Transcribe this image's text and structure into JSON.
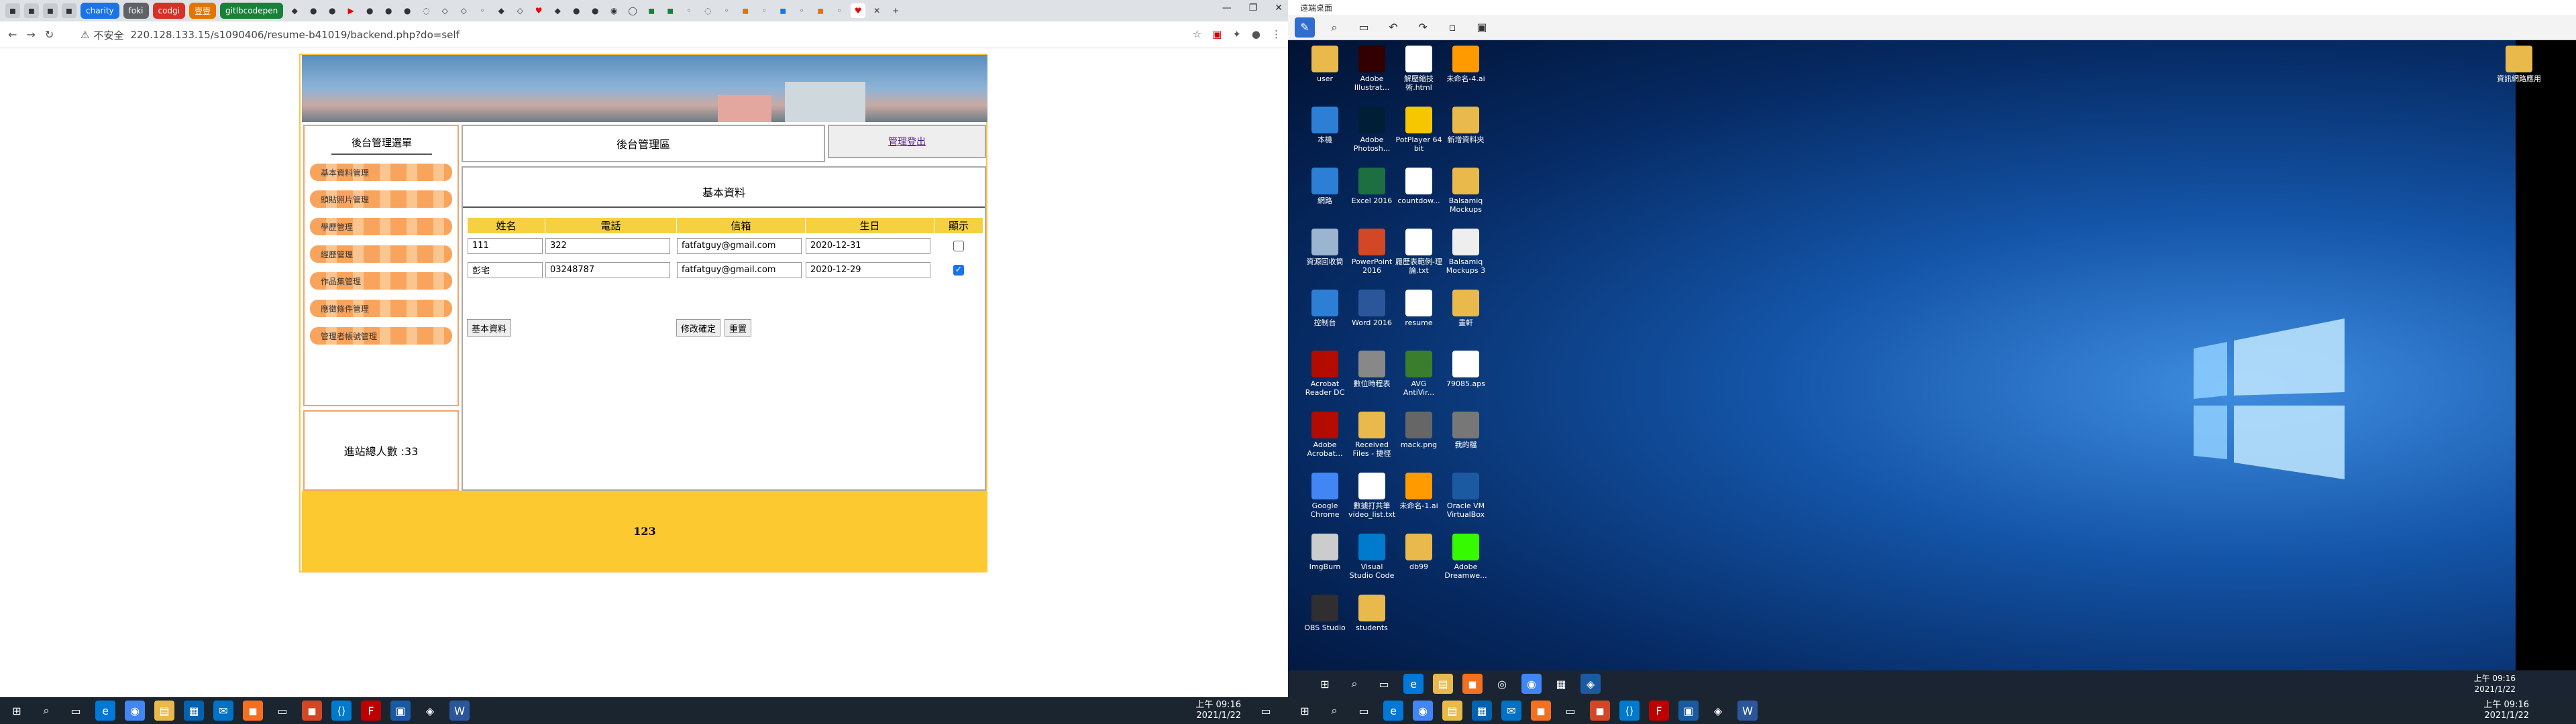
{
  "browser": {
    "tabs": [
      "charity",
      "foki",
      "codgi",
      "壹壹",
      "gitlbcodepen"
    ],
    "tab_colors": [
      "#1a73e8",
      "#5f6368",
      "#d93025",
      "#e37400",
      "#188038"
    ],
    "security_label": "不安全",
    "url": "220.128.133.15/s1090406/resume-b41019/backend.php?do=self"
  },
  "site": {
    "menu_title": "後台管理選單",
    "menu_items": [
      "基本資料管理",
      "頭貼照片管理",
      "學歷管理",
      "經歷管理",
      "作品集管理",
      "應徵條件管理",
      "管理者帳號管理"
    ],
    "visit_label": "進站總人數 :33",
    "header_title": "後台管理區",
    "logout_label": "管理登出",
    "content_title": "基本資料",
    "table": {
      "headers": [
        "姓名",
        "電話",
        "信箱",
        "生日",
        "顯示"
      ],
      "rows": [
        {
          "name": "111",
          "phone": "322",
          "email": "fatfatguy@gmail.com",
          "birthday": "2020-12-31",
          "show": false
        },
        {
          "name": "彭宅",
          "phone": "03248787",
          "email": "fatfatguy@gmail.com",
          "birthday": "2020-12-29",
          "show": true
        }
      ]
    },
    "btn_basic": "基本資料",
    "btn_confirm": "修改確定",
    "btn_reset": "重置",
    "footer": "123"
  },
  "left_taskbar": {
    "time": "上午 09:16",
    "date": "2021/1/22"
  },
  "remote": {
    "title": "遠端桌面",
    "desktop_icons": [
      {
        "label": "user",
        "color": "#e9b94b"
      },
      {
        "label": "Adobe Illustrat...",
        "color": "#330000"
      },
      {
        "label": "解壓縮技術.html",
        "color": "#ffffff"
      },
      {
        "label": "未命名-4.ai",
        "color": "#ff9a00"
      },
      {
        "label": "本機",
        "color": "#2d7fd6"
      },
      {
        "label": "Adobe Photosh...",
        "color": "#001e36"
      },
      {
        "label": "PotPlayer 64 bit",
        "color": "#f6c700"
      },
      {
        "label": "新增資料夾",
        "color": "#e9b94b"
      },
      {
        "label": "網路",
        "color": "#2d7fd6"
      },
      {
        "label": "Excel 2016",
        "color": "#1d6f42"
      },
      {
        "label": "countdow...",
        "color": "#ffffff"
      },
      {
        "label": "Balsamiq Mockups",
        "color": "#e9b94b"
      },
      {
        "label": "資源回收筒",
        "color": "#9bb4cf"
      },
      {
        "label": "PowerPoint 2016",
        "color": "#d24726"
      },
      {
        "label": "履歷表範例-理論.txt",
        "color": "#ffffff"
      },
      {
        "label": "Balsamiq Mockups 3",
        "color": "#eeeeee"
      },
      {
        "label": "控制台",
        "color": "#2d7fd6"
      },
      {
        "label": "Word 2016",
        "color": "#2b579a"
      },
      {
        "label": "resume",
        "color": "#ffffff"
      },
      {
        "label": "畫軒",
        "color": "#e9b94b"
      },
      {
        "label": "Acrobat Reader DC",
        "color": "#b30b00"
      },
      {
        "label": "數位時程表",
        "color": "#888888"
      },
      {
        "label": "AVG AntiVir...",
        "color": "#3a7d2c"
      },
      {
        "label": "79085.aps",
        "color": "#ffffff"
      },
      {
        "label": "Adobe Acrobat...",
        "color": "#b30b00"
      },
      {
        "label": "Received Files - 捷徑",
        "color": "#e9b94b"
      },
      {
        "label": "mack.png",
        "color": "#666666"
      },
      {
        "label": "我的檔",
        "color": "#777777"
      },
      {
        "label": "Google Chrome",
        "color": "#4285f4"
      },
      {
        "label": "數據打共筆 video_list.txt",
        "color": "#ffffff"
      },
      {
        "label": "未命名-1.ai",
        "color": "#ff9a00"
      },
      {
        "label": "Oracle VM VirtualBox",
        "color": "#1b5aa0"
      },
      {
        "label": "ImgBurn",
        "color": "#cccccc"
      },
      {
        "label": "Visual Studio Code",
        "color": "#007acc"
      },
      {
        "label": "db99",
        "color": "#e9b94b"
      },
      {
        "label": "Adobe Dreamwe...",
        "color": "#35fa00"
      },
      {
        "label": "OBS Studio",
        "color": "#302e31"
      },
      {
        "label": "students",
        "color": "#e9b94b"
      }
    ],
    "right_folder": "資訊網路應用",
    "time": "上午 09:16",
    "date": "2021/1/22"
  }
}
